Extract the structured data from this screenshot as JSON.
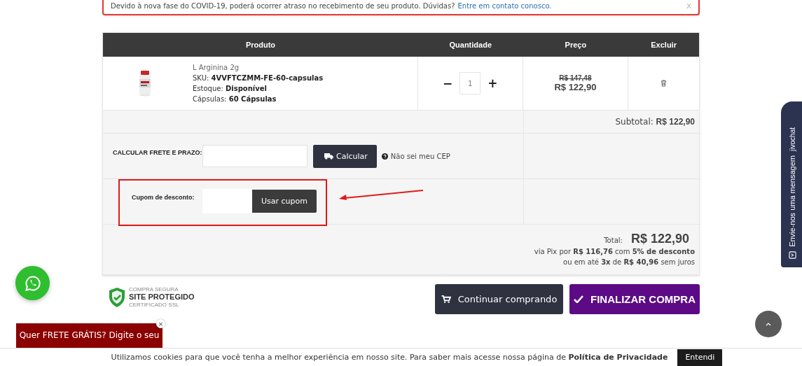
{
  "notice": {
    "text": "Devido à nova fase do COVID-19, poderá ocorrer atraso no recebimento de seu produto. Dúvidas?",
    "link": "Entre em contato conosco.",
    "close": "x"
  },
  "cart": {
    "columns": [
      "Produto",
      "Quantidade",
      "Preço",
      "Excluir"
    ],
    "items": [
      {
        "name": "L Arginina 2g",
        "details": [
          {
            "label": "SKU:",
            "value": "4VVFTCZMM-FE-60-capsulas"
          },
          {
            "label": "Estoque:",
            "value": "Disponível"
          },
          {
            "label": "Cápsulas:",
            "value": "60 Cápsulas"
          }
        ],
        "decrement": "−",
        "quantity": "1",
        "increment": "+",
        "old_price": "R$ 147,48",
        "price": "R$ 122,90"
      }
    ]
  },
  "subtotal": {
    "label": "Subtotal:",
    "value": "R$ 122,90"
  },
  "shipping": {
    "label": "CALCULAR FRETE E PRAZO:",
    "button": "Calcular",
    "help": "Não sei meu CEP"
  },
  "coupon": {
    "label": "Cupom de desconto:",
    "button": "Usar cupom"
  },
  "total": {
    "label": "Total:",
    "value": "R$ 122,90",
    "pix": "via Pix por **R$ 116,76** com **5% de desconto**",
    "installments": "ou em até **3x** de **R$ 40,96** sem juros"
  },
  "seal": {
    "top": "COMPRA SEGURA",
    "main": "SITE PROTEGIDO",
    "bottom": "CERTIFICADO SSL"
  },
  "actions": [
    {
      "label": "Continuar comprando",
      "kind": "secondary"
    },
    {
      "label": "FINALIZAR COMPRA",
      "kind": "primary"
    }
  ],
  "promo": {
    "text": "Quer FRETE GRÁTIS? Digite o seu",
    "close": "×"
  },
  "chat": {
    "text": "Envie-nos uma mensagem",
    "brand": "jivochat"
  },
  "cookie": {
    "text": "Utilizamos cookies para que você tenha a melhor experiência em nosso site. Para saber mais acesse nossa página de **Política de Privacidade**",
    "button": "Entendi"
  }
}
